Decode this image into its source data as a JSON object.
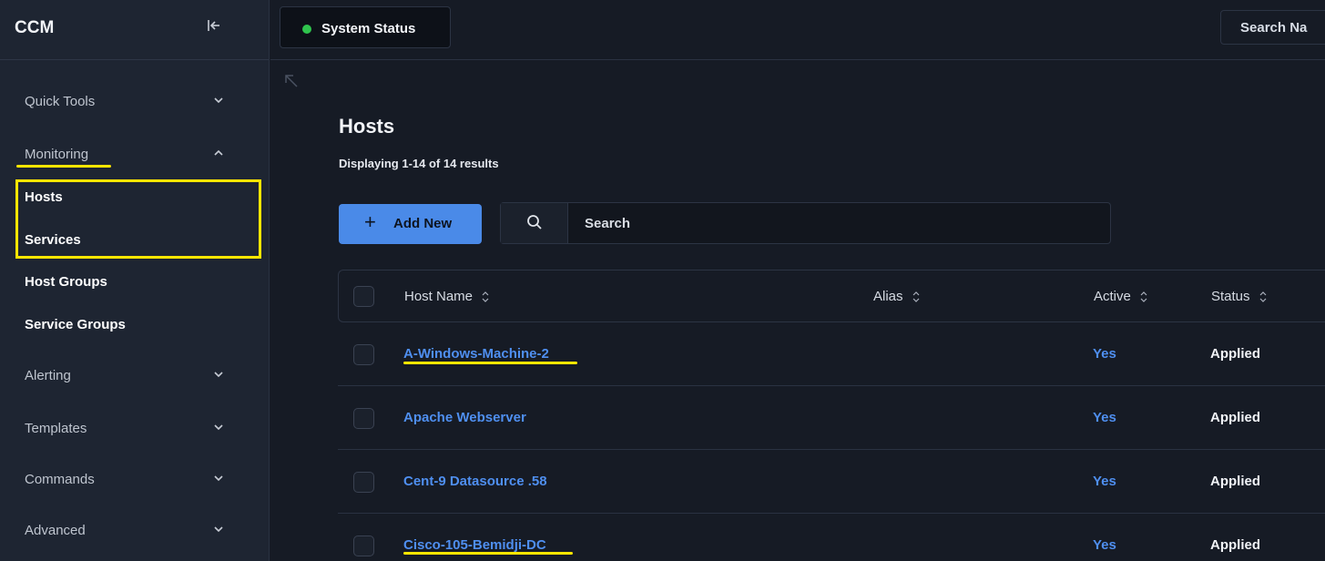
{
  "app": {
    "title": "CCM"
  },
  "sidebar": {
    "items": [
      {
        "label": "Quick Tools",
        "type": "section",
        "expanded": false
      },
      {
        "label": "Monitoring",
        "type": "section",
        "expanded": true
      },
      {
        "label": "Hosts",
        "type": "sub"
      },
      {
        "label": "Services",
        "type": "sub"
      },
      {
        "label": "Host Groups",
        "type": "sub"
      },
      {
        "label": "Service Groups",
        "type": "sub"
      },
      {
        "label": "Alerting",
        "type": "section",
        "expanded": false
      },
      {
        "label": "Templates",
        "type": "section",
        "expanded": false
      },
      {
        "label": "Commands",
        "type": "section",
        "expanded": false
      },
      {
        "label": "Advanced",
        "type": "section",
        "expanded": false
      }
    ]
  },
  "topbar": {
    "status_label": "System Status",
    "status_color": "#2fc44d",
    "search_label": "Search Na"
  },
  "page": {
    "title": "Hosts",
    "result_count": "Displaying 1-14 of 14 results",
    "add_label": "Add New",
    "search_placeholder": "Search"
  },
  "table": {
    "columns": [
      "Host Name",
      "Alias",
      "Active",
      "Status"
    ],
    "rows": [
      {
        "host": "A-Windows-Machine-2",
        "alias": "",
        "active": "Yes",
        "status": "Applied"
      },
      {
        "host": "Apache Webserver",
        "alias": "",
        "active": "Yes",
        "status": "Applied"
      },
      {
        "host": "Cent-9 Datasource .58",
        "alias": "",
        "active": "Yes",
        "status": "Applied"
      },
      {
        "host": "Cisco-105-Bemidji-DC",
        "alias": "",
        "active": "Yes",
        "status": "Applied"
      }
    ]
  },
  "colors": {
    "accent": "#4a8ae8",
    "link": "#4f8ff0",
    "highlight": "#ffe600",
    "sidebar_bg": "#1e2532",
    "page_bg": "#161b25"
  }
}
